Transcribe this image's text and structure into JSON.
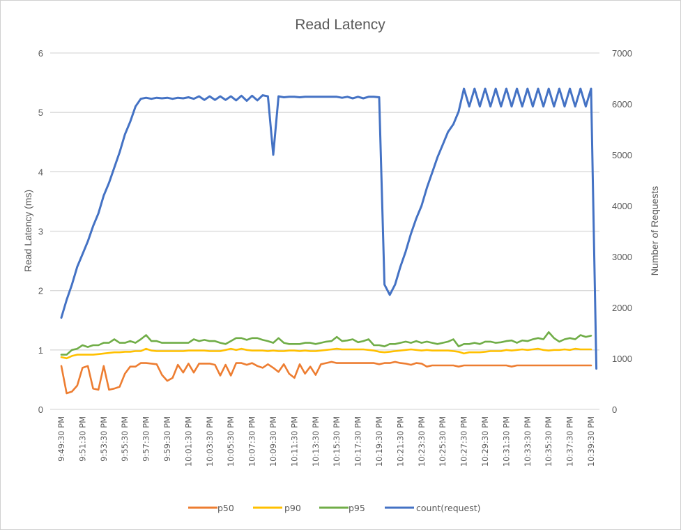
{
  "chart_data": {
    "type": "line",
    "title": "Read Latency",
    "xlabel": "",
    "ylabel": "Read Latency (ms)",
    "y2label": "Number of Requests",
    "ylim": [
      0,
      6
    ],
    "y2lim": [
      0,
      7000
    ],
    "yticks": [
      "0",
      "1",
      "2",
      "3",
      "4",
      "5",
      "6"
    ],
    "y2ticks": [
      "0",
      "1000",
      "2000",
      "3000",
      "4000",
      "5000",
      "6000",
      "7000"
    ],
    "grid": true,
    "legend_position": "bottom",
    "x_tick_labels": [
      "9:49:30 PM",
      "9:51:30 PM",
      "9:53:30 PM",
      "9:55:30 PM",
      "9:57:30 PM",
      "9:59:30 PM",
      "10:01:30 PM",
      "10:03:30 PM",
      "10:05:30 PM",
      "10:07:30 PM",
      "10:09:30 PM",
      "10:11:30 PM",
      "10:13:30 PM",
      "10:15:30 PM",
      "10:17:30 PM",
      "10:19:30 PM",
      "10:21:30 PM",
      "10:23:30 PM",
      "10:25:30 PM",
      "10:27:30 PM",
      "10:29:30 PM",
      "10:31:30 PM",
      "10:33:30 PM",
      "10:35:30 PM",
      "10:37:30 PM",
      "10:39:30 PM"
    ],
    "x_interval_seconds": 30,
    "point_count": 101,
    "series": [
      {
        "name": "p50",
        "axis": "left",
        "color": "#ED7D31",
        "values": [
          0.73,
          0.27,
          0.3,
          0.4,
          0.7,
          0.73,
          0.35,
          0.33,
          0.73,
          0.33,
          0.35,
          0.38,
          0.6,
          0.72,
          0.72,
          0.78,
          0.78,
          0.77,
          0.76,
          0.58,
          0.48,
          0.53,
          0.75,
          0.62,
          0.77,
          0.62,
          0.77,
          0.77,
          0.77,
          0.75,
          0.57,
          0.75,
          0.57,
          0.78,
          0.78,
          0.75,
          0.78,
          0.73,
          0.7,
          0.76,
          0.7,
          0.63,
          0.76,
          0.6,
          0.53,
          0.76,
          0.6,
          0.72,
          0.58,
          0.76,
          0.78,
          0.8,
          0.78,
          0.78,
          0.78,
          0.78,
          0.78,
          0.78,
          0.78,
          0.78,
          0.76,
          0.78,
          0.78,
          0.8,
          0.78,
          0.77,
          0.75,
          0.78,
          0.77,
          0.72,
          0.74,
          0.74,
          0.74,
          0.74,
          0.74,
          0.72,
          0.74,
          0.74,
          0.74,
          0.74,
          0.74,
          0.74,
          0.74,
          0.74,
          0.74,
          0.72,
          0.74,
          0.74,
          0.74,
          0.74,
          0.74,
          0.74,
          0.74,
          0.74,
          0.74,
          0.74,
          0.74,
          0.74,
          0.74,
          0.74,
          0.74
        ]
      },
      {
        "name": "p90",
        "axis": "left",
        "color": "#FFC000",
        "values": [
          0.88,
          0.86,
          0.9,
          0.92,
          0.92,
          0.92,
          0.92,
          0.93,
          0.94,
          0.95,
          0.96,
          0.96,
          0.97,
          0.97,
          0.98,
          0.98,
          1.02,
          0.99,
          0.98,
          0.98,
          0.98,
          0.98,
          0.98,
          0.98,
          0.99,
          0.99,
          0.99,
          0.99,
          0.98,
          0.98,
          0.98,
          1.0,
          1.02,
          1.0,
          1.02,
          1.0,
          0.99,
          0.99,
          0.99,
          0.98,
          0.99,
          0.98,
          0.98,
          0.99,
          0.99,
          0.98,
          0.99,
          0.98,
          0.98,
          0.99,
          1.0,
          1.01,
          1.02,
          1.01,
          1.01,
          1.01,
          1.01,
          1.01,
          1.0,
          0.99,
          0.97,
          0.96,
          0.97,
          0.98,
          0.99,
          1.0,
          1.01,
          1.0,
          0.99,
          1.0,
          0.99,
          0.99,
          0.99,
          0.99,
          0.98,
          0.97,
          0.94,
          0.96,
          0.96,
          0.96,
          0.97,
          0.98,
          0.98,
          0.98,
          1.0,
          0.99,
          1.0,
          1.01,
          1.0,
          1.01,
          1.02,
          1.0,
          0.99,
          1.0,
          1.0,
          1.01,
          1.0,
          1.02,
          1.01,
          1.01,
          1.01
        ]
      },
      {
        "name": "p95",
        "axis": "left",
        "color": "#70AD47",
        "values": [
          0.92,
          0.92,
          1.0,
          1.02,
          1.08,
          1.05,
          1.08,
          1.08,
          1.12,
          1.12,
          1.18,
          1.12,
          1.12,
          1.15,
          1.12,
          1.18,
          1.25,
          1.15,
          1.15,
          1.12,
          1.12,
          1.12,
          1.12,
          1.12,
          1.12,
          1.18,
          1.15,
          1.17,
          1.15,
          1.15,
          1.12,
          1.1,
          1.15,
          1.2,
          1.2,
          1.17,
          1.2,
          1.2,
          1.17,
          1.15,
          1.12,
          1.2,
          1.12,
          1.1,
          1.1,
          1.1,
          1.12,
          1.12,
          1.1,
          1.12,
          1.14,
          1.15,
          1.22,
          1.15,
          1.16,
          1.18,
          1.13,
          1.15,
          1.18,
          1.08,
          1.08,
          1.06,
          1.1,
          1.1,
          1.12,
          1.14,
          1.12,
          1.15,
          1.12,
          1.14,
          1.12,
          1.1,
          1.12,
          1.14,
          1.18,
          1.06,
          1.1,
          1.1,
          1.12,
          1.1,
          1.14,
          1.14,
          1.12,
          1.13,
          1.15,
          1.16,
          1.12,
          1.16,
          1.15,
          1.18,
          1.2,
          1.18,
          1.3,
          1.2,
          1.14,
          1.18,
          1.2,
          1.18,
          1.25,
          1.22,
          1.24
        ]
      },
      {
        "name": "count(request)",
        "axis": "right",
        "color": "#4472C4",
        "values": [
          1800,
          2150,
          2450,
          2800,
          3050,
          3300,
          3600,
          3850,
          4200,
          4450,
          4750,
          5050,
          5400,
          5650,
          5950,
          6100,
          6120,
          6100,
          6120,
          6110,
          6120,
          6100,
          6120,
          6110,
          6130,
          6100,
          6150,
          6080,
          6150,
          6080,
          6150,
          6080,
          6150,
          6070,
          6160,
          6060,
          6160,
          6070,
          6170,
          6150,
          5000,
          6150,
          6130,
          6140,
          6140,
          6130,
          6140,
          6140,
          6140,
          6140,
          6140,
          6140,
          6140,
          6120,
          6140,
          6110,
          6140,
          6110,
          6140,
          6140,
          6130,
          2450,
          2250,
          2450,
          2800,
          3100,
          3450,
          3750,
          4000,
          4350,
          4650,
          4950,
          5200,
          5450,
          5600,
          5850,
          6300,
          5950,
          6300,
          5950,
          6300,
          5950,
          6300,
          5950,
          6300,
          5950,
          6300,
          5950,
          6300,
          5950,
          6300,
          5950,
          6300,
          5950,
          6300,
          5950,
          6300,
          5950,
          6300,
          5950,
          6300,
          800
        ]
      }
    ]
  }
}
